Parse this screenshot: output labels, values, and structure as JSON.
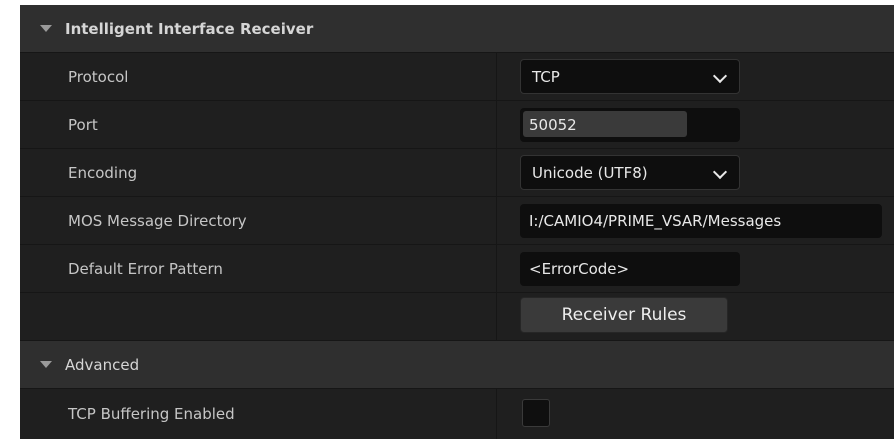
{
  "panel": {
    "category_main": {
      "title": "Intelligent Interface Receiver"
    },
    "protocol": {
      "label": "Protocol",
      "value": "TCP"
    },
    "port": {
      "label": "Port",
      "value": "50052"
    },
    "encoding": {
      "label": "Encoding",
      "value": "Unicode (UTF8)"
    },
    "mos_dir": {
      "label": "MOS Message Directory",
      "value": "I:/CAMIO4/PRIME_VSAR/Messages"
    },
    "error_pattern": {
      "label": "Default Error Pattern",
      "value": "<ErrorCode>"
    },
    "receiver_rules": {
      "label": "Receiver Rules"
    },
    "category_advanced": {
      "title": "Advanced"
    },
    "tcp_buffering": {
      "label": "TCP Buffering Enabled",
      "checked": false
    }
  },
  "icons": {
    "category_toggle": "triangle-down-icon",
    "combo_arrow": "chevron-down-icon"
  },
  "colors": {
    "panel_bg": "#242424",
    "row_bg": "#1f1f1f",
    "category_bg": "#2f2f2f",
    "input_bg": "#0e0e0e",
    "button_bg": "#3a3a3a",
    "text": "#c6c6c6"
  }
}
